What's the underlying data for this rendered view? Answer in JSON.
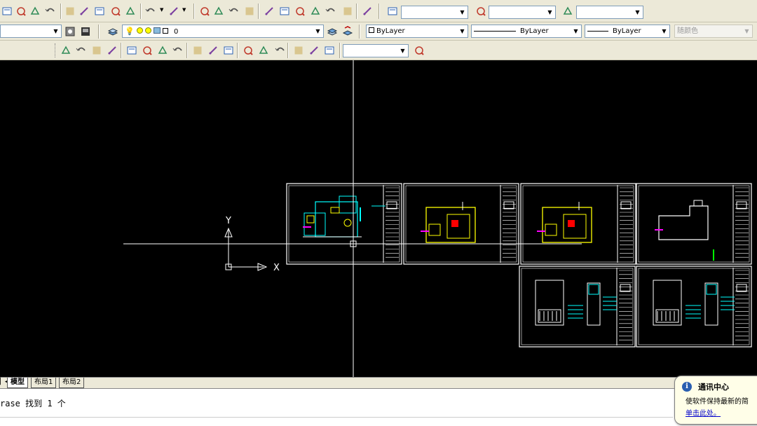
{
  "toolbar1": {
    "icons": [
      "preview-icon",
      "publish-icon",
      "plot-icon",
      "3d-dwf-icon",
      "cut-icon",
      "copy-icon",
      "paste-icon",
      "match-properties-icon",
      "block-editor-icon",
      "undo-icon",
      "undo-dropdown-icon",
      "redo-icon",
      "redo-dropdown-icon",
      "pan-icon",
      "zoom-realtime-icon",
      "zoom-window-icon",
      "zoom-previous-icon",
      "properties-icon",
      "design-center-icon",
      "tool-palettes-icon",
      "sheet-set-icon",
      "markup-icon",
      "quickcalc-icon",
      "help-icon",
      "text-style-icon",
      "dim-style-icon",
      "table-style-icon"
    ],
    "text_style_value": "",
    "dim_style_value": "",
    "table_style_value": ""
  },
  "toolbar2": {
    "workspace_value": "",
    "layer_value": "0",
    "color_value": "ByLayer",
    "linetype_value": "ByLayer",
    "lineweight_value": "ByLayer",
    "plotstyle_value": "随颜色"
  },
  "toolbar3": {
    "icons": [
      "dim-linear-icon",
      "dim-aligned-icon",
      "dim-arc-icon",
      "dim-ordinate-icon",
      "dim-radius-icon",
      "dim-jogged-icon",
      "dim-diameter-icon",
      "dim-angular-icon",
      "quick-dim-icon",
      "dim-baseline-icon",
      "dim-continue-icon",
      "quick-leader-icon",
      "tolerance-icon",
      "center-mark-icon",
      "dim-edit-icon",
      "dim-text-edit-icon",
      "dim-update-icon",
      "dim-style-icon-2"
    ],
    "dim_style_combo": ""
  },
  "ucs": {
    "x_label": "X",
    "y_label": "Y"
  },
  "tabs": [
    {
      "label": "模型",
      "active": true
    },
    {
      "label": "布局1",
      "active": false
    },
    {
      "label": "布局2",
      "active": false
    }
  ],
  "command": {
    "history": "rase 找到 1 个"
  },
  "balloon": {
    "title": "通讯中心",
    "body": "使软件保持最新的简",
    "link": "单击此处。"
  },
  "colors": {
    "canvas": "#000000",
    "frame": "#ffffff",
    "cyan": "#00ffff",
    "yellow": "#ffff00",
    "magenta": "#ff00ff",
    "red": "#ff0000",
    "green": "#00ff00"
  }
}
